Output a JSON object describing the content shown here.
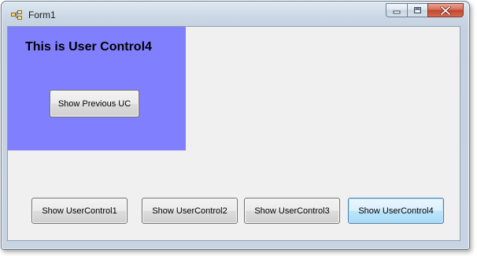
{
  "window": {
    "title": "Form1",
    "caption_buttons": {
      "minimize": "minimize-icon",
      "maximize": "maximize-icon",
      "close": "close-icon"
    }
  },
  "user_control": {
    "title": "This is User Control4",
    "background_color": "#8080ff",
    "prev_button_label": "Show Previous UC"
  },
  "buttons": {
    "uc1": "Show UserControl1",
    "uc2": "Show UserControl2",
    "uc3": "Show UserControl3",
    "uc4": "Show UserControl4"
  }
}
